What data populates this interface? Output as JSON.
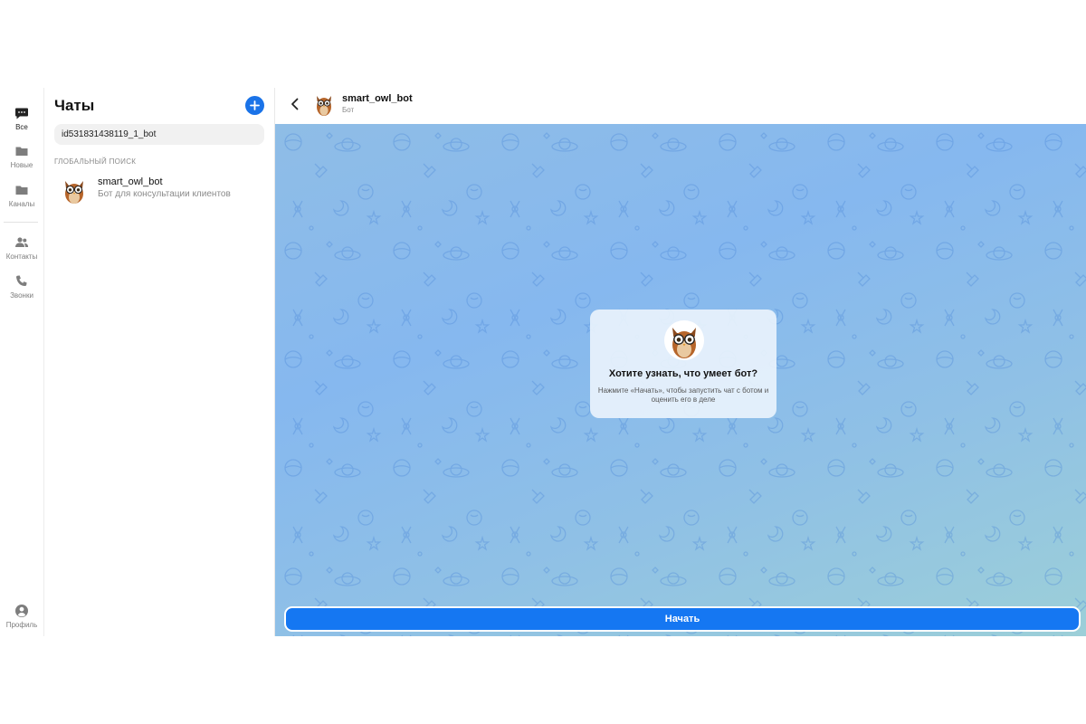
{
  "rail": {
    "items": [
      {
        "label": "Все",
        "icon": "chat-bubble-icon",
        "active": true
      },
      {
        "label": "Новые",
        "icon": "folder-icon",
        "active": false
      },
      {
        "label": "Каналы",
        "icon": "folder-icon",
        "active": false
      },
      {
        "label": "Контакты",
        "icon": "people-icon",
        "active": false
      },
      {
        "label": "Звонки",
        "icon": "phone-icon",
        "active": false
      }
    ],
    "profile": {
      "label": "Профиль",
      "icon": "profile-icon"
    }
  },
  "sidebar": {
    "title": "Чаты",
    "new_chat_icon": "plus-icon",
    "search": {
      "value": "id531831438119_1_bot",
      "placeholder": ""
    },
    "section_label": "ГЛОБАЛЬНЫЙ ПОИСК",
    "results": [
      {
        "name": "smart_owl_bot",
        "description": "Бот для консультации клиентов",
        "avatar": "owl-avatar"
      }
    ]
  },
  "chat": {
    "back_icon": "chevron-left-icon",
    "header": {
      "name": "smart_owl_bot",
      "subtitle": "Бот",
      "avatar": "owl-avatar"
    },
    "intro_card": {
      "title": "Хотите узнать, что умеет бот?",
      "text": "Нажмите «Начать», чтобы запустить чат с ботом и оценить его в деле",
      "avatar": "owl-avatar"
    },
    "start_button": "Начать"
  },
  "colors": {
    "accent": "#1577f2",
    "background_top": "#86b8ef",
    "background_bottom": "#9ccfd8"
  }
}
